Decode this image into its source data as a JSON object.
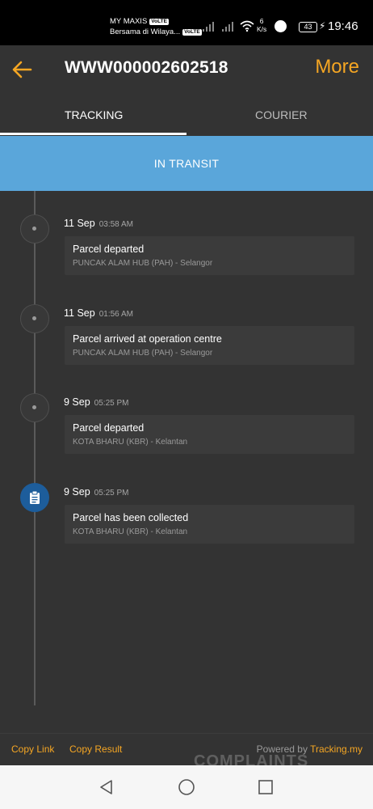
{
  "status_bar": {
    "carrier_line1": "MY MAXIS",
    "carrier_line2": "Bersama di Wilaya...",
    "volte": "VoLTE",
    "speed_value": "6",
    "speed_unit": "K/s",
    "battery": "43",
    "time": "19:46"
  },
  "header": {
    "title": "WWW000002602518",
    "more_label": "More"
  },
  "tabs": [
    {
      "label": "TRACKING",
      "active": true
    },
    {
      "label": "COURIER",
      "active": false
    }
  ],
  "banner": {
    "status": "IN TRANSIT",
    "color": "#5aa6da"
  },
  "events": [
    {
      "date": "11 Sep",
      "time": "03:58 AM",
      "description": "Parcel departed",
      "location": "PUNCAK ALAM HUB (PAH) - Selangor"
    },
    {
      "date": "11 Sep",
      "time": "01:56 AM",
      "description": "Parcel arrived at operation centre",
      "location": "PUNCAK ALAM HUB (PAH) - Selangor"
    },
    {
      "date": "9 Sep",
      "time": "05:25 PM",
      "description": "Parcel departed",
      "location": "KOTA BHARU (KBR) - Kelantan"
    },
    {
      "date": "9 Sep",
      "time": "05:25 PM",
      "description": "Parcel has been collected",
      "location": "KOTA BHARU (KBR) - Kelantan",
      "icon": "clipboard-icon"
    }
  ],
  "footer": {
    "copy_link": "Copy Link",
    "copy_result": "Copy Result",
    "powered_by": "Powered by ",
    "brand": "Tracking.my",
    "watermark": "COMPLAINTS"
  },
  "colors": {
    "accent": "#f5a623",
    "background": "#333333",
    "active_node": "#1d5d9b"
  },
  "nav": {
    "back": "back-triangle-icon",
    "home": "home-circle-icon",
    "recents": "recents-square-icon"
  }
}
